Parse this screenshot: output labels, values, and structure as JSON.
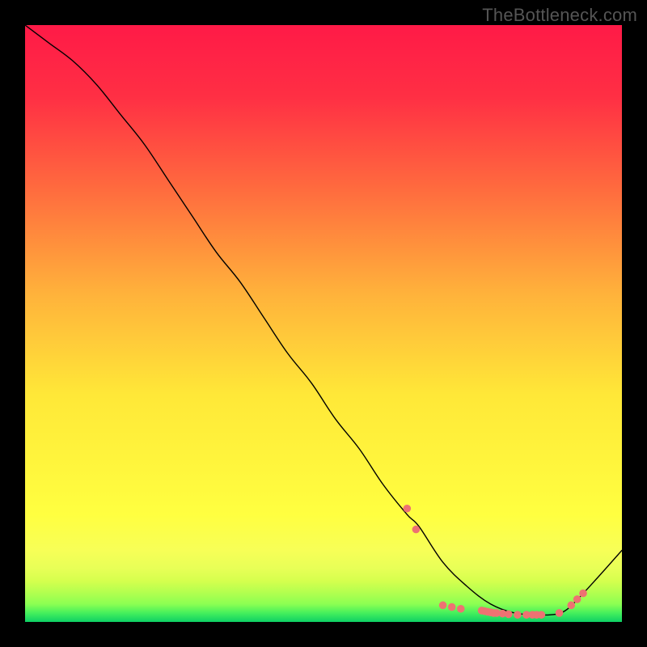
{
  "watermark": "TheBottleneck.com",
  "chart_data": {
    "type": "line",
    "title": "",
    "xlabel": "",
    "ylabel": "",
    "xlim": [
      0,
      100
    ],
    "ylim": [
      0,
      100
    ],
    "grid": false,
    "legend": false,
    "background_gradient": {
      "top_color": "#ff1a47",
      "mid_color": "#ffe838",
      "lower_band_colors": [
        "#f7ff57",
        "#d7ff4e",
        "#8cff52",
        "#22e26c",
        "#0ecf64"
      ],
      "bottom_color": "#0ecf64"
    },
    "series": [
      {
        "name": "curve",
        "color": "#000000",
        "stroke_width": 1.4,
        "x": [
          0,
          4,
          8,
          12,
          16,
          20,
          24,
          28,
          32,
          36,
          40,
          44,
          48,
          52,
          56,
          60,
          64,
          66,
          70,
          74,
          78,
          82,
          86,
          88,
          90,
          92,
          96,
          100
        ],
        "y": [
          100,
          97,
          94,
          90,
          85,
          80,
          74,
          68,
          62,
          57,
          51,
          45,
          40,
          34,
          29,
          23,
          18,
          16,
          10,
          6,
          3,
          1.5,
          1.2,
          1.2,
          1.6,
          3.2,
          7.5,
          12
        ]
      }
    ],
    "highlight_points": {
      "color": "#ee7272",
      "radius": 4.8,
      "points": [
        {
          "x": 64.0,
          "y": 19.0
        },
        {
          "x": 65.5,
          "y": 15.5
        },
        {
          "x": 70.0,
          "y": 2.8
        },
        {
          "x": 71.5,
          "y": 2.5
        },
        {
          "x": 73.0,
          "y": 2.2
        },
        {
          "x": 76.5,
          "y": 1.9
        },
        {
          "x": 77.0,
          "y": 1.8
        },
        {
          "x": 77.5,
          "y": 1.7
        },
        {
          "x": 78.0,
          "y": 1.6
        },
        {
          "x": 78.5,
          "y": 1.5
        },
        {
          "x": 79.0,
          "y": 1.5
        },
        {
          "x": 80.0,
          "y": 1.4
        },
        {
          "x": 81.0,
          "y": 1.3
        },
        {
          "x": 82.5,
          "y": 1.2
        },
        {
          "x": 84.0,
          "y": 1.2
        },
        {
          "x": 85.0,
          "y": 1.2
        },
        {
          "x": 85.7,
          "y": 1.2
        },
        {
          "x": 86.5,
          "y": 1.2
        },
        {
          "x": 89.5,
          "y": 1.5
        },
        {
          "x": 91.5,
          "y": 2.8
        },
        {
          "x": 92.5,
          "y": 3.8
        },
        {
          "x": 93.5,
          "y": 4.8
        }
      ]
    }
  }
}
